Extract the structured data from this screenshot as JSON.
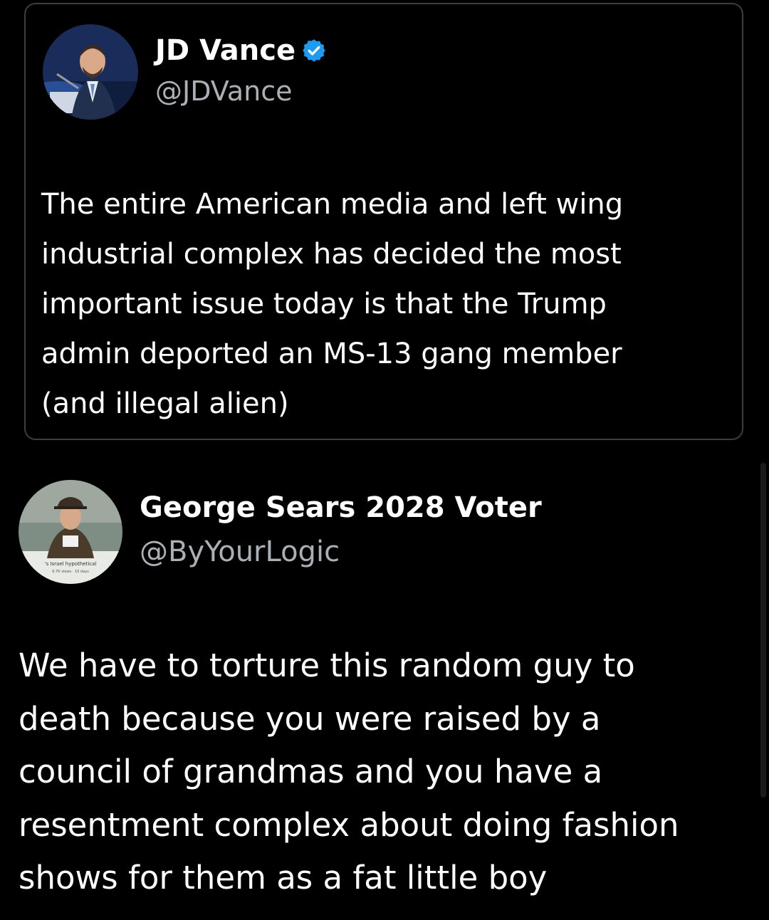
{
  "quoted_tweet": {
    "author_name": "JD Vance",
    "handle": "@JDVance",
    "verified_icon": "verified-badge-icon",
    "text": "The entire American media and left wing\nindustrial complex has decided the most\nimportant issue today is that the Trump\nadmin deported an MS-13 gang member\n(and illegal alien)"
  },
  "reply_tweet": {
    "author_name": "George Sears 2028 Voter",
    "handle": "@ByYourLogic",
    "text": "We have to torture this random guy to\ndeath because you were raised by a\ncouncil of grandmas and you have a\nresentment complex about doing fashion\nshows for them as a fat little boy"
  },
  "colors": {
    "background": "#000000",
    "text_primary": "#ffffff",
    "text_secondary": "#aab0b6",
    "card_border": "#3a3d41",
    "verified_badge": "#1d9bf0"
  }
}
